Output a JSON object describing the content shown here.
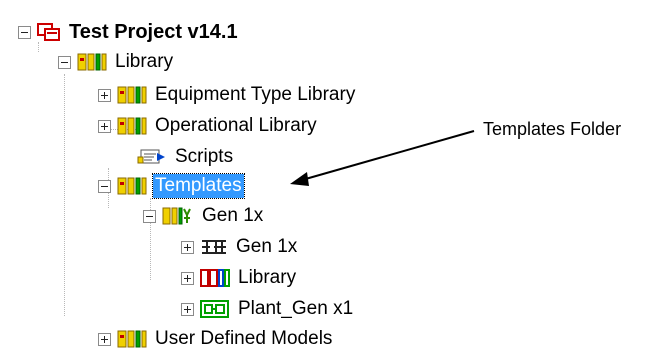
{
  "tree": {
    "root": {
      "label": "Test Project v14.1",
      "expanded": true,
      "icon": "project-icon"
    },
    "items": [
      {
        "label": "Library",
        "expanded": true,
        "icon": "library-icon"
      },
      {
        "label": "Equipment Type Library",
        "expanded": false,
        "icon": "library-icon"
      },
      {
        "label": "Operational Library",
        "expanded": false,
        "icon": "library-icon"
      },
      {
        "label": "Scripts",
        "icon": "scripts-icon"
      },
      {
        "label": "Templates",
        "expanded": true,
        "selected": true,
        "icon": "library-icon"
      },
      {
        "label": "Gen 1x",
        "expanded": true,
        "icon": "template-icon"
      },
      {
        "label": "Gen 1x",
        "expanded": false,
        "icon": "graphic-icon"
      },
      {
        "label": "Library",
        "expanded": false,
        "icon": "type-library-icon"
      },
      {
        "label": "Plant_Gen x1",
        "expanded": false,
        "icon": "plant-icon"
      },
      {
        "label": "User Defined Models",
        "expanded": false,
        "icon": "library-icon"
      }
    ]
  },
  "annotation": {
    "text": "Templates Folder"
  },
  "colors": {
    "selection": "#3399ff",
    "library_icon": "#c8a000",
    "project_icon": "#cc0000",
    "arrow": "#000000"
  }
}
